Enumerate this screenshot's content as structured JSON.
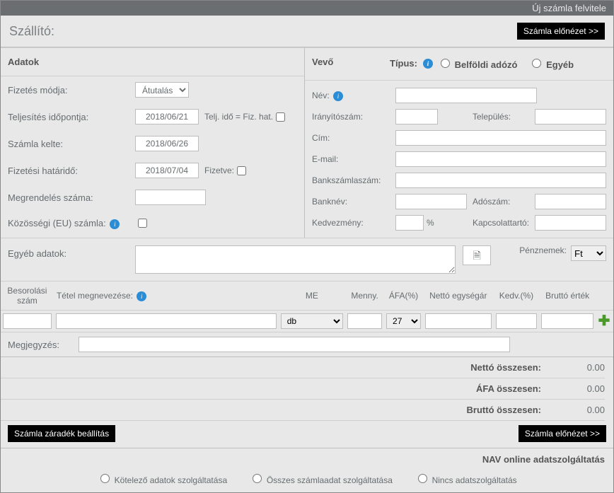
{
  "window_title": "Új számla felvitele",
  "header": {
    "szallito_label": "Szállító:",
    "preview_button": "Számla előnézet >>"
  },
  "left": {
    "section_title": "Adatok",
    "payment_method_label": "Fizetés módja:",
    "payment_method_value": "Átutalás",
    "fulfillment_date_label": "Teljesítés időpontja:",
    "fulfillment_date_value": "2018/06/21",
    "fulfillment_after": "Telj. idő = Fiz. hat.",
    "invoice_date_label": "Számla kelte:",
    "invoice_date_value": "2018/06/26",
    "due_date_label": "Fizetési határidő:",
    "due_date_value": "2018/07/04",
    "paid_label": "Fizetve:",
    "order_number_label": "Megrendelés száma:",
    "eu_invoice_label": "Közösségi (EU) számla:"
  },
  "right": {
    "vevo_label": "Vevő",
    "tipus_label": "Típus:",
    "tipus_option1": "Belföldi adózó",
    "tipus_option2": "Egyéb",
    "name_label": "Név:",
    "zip_label": "Irányítószám:",
    "city_label": "Település:",
    "address_label": "Cím:",
    "email_label": "E-mail:",
    "bankacct_label": "Bankszámlaszám:",
    "bankname_label": "Banknév:",
    "tax_label": "Adószám:",
    "discount_label": "Kedvezmény:",
    "percent": "%",
    "contact_label": "Kapcsolattartó:"
  },
  "egy": {
    "label": "Egyéb adatok:",
    "pn_label": "Pénznemek:",
    "pn_value": "Ft"
  },
  "items": {
    "col_besor": "Besorolási szám",
    "col_name": "Tétel megnevezése:",
    "col_me": "ME",
    "col_qty": "Menny.",
    "col_vat": "ÁFA(%)",
    "col_unit": "Nettó egységár",
    "col_disc": "Kedv.(%)",
    "col_gross": "Bruttó érték",
    "me_value": "db",
    "vat_value": "27"
  },
  "megj_label": "Megjegyzés:",
  "totals": {
    "net_label": "Nettó összesen:",
    "net_val": "0.00",
    "vat_label": "ÁFA összesen:",
    "vat_val": "0.00",
    "gross_label": "Bruttó összesen:",
    "gross_val": "0.00"
  },
  "footer": {
    "clause_btn": "Számla záradék beállítás",
    "preview_btn": "Számla előnézet >>"
  },
  "nav": {
    "title": "NAV online adatszolgáltatás",
    "opt1": "Kötelező adatok szolgáltatása",
    "opt2": "Összes számlaadat szolgáltatása",
    "opt3": "Nincs adatszolgáltatás"
  }
}
